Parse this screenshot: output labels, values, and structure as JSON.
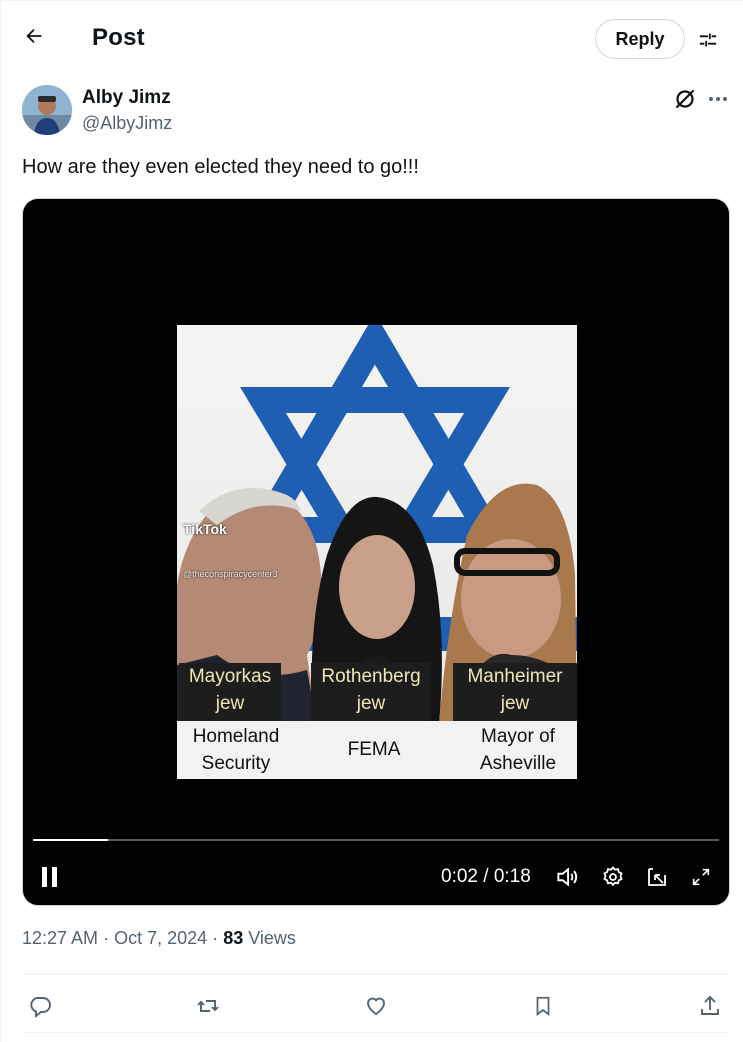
{
  "header": {
    "title": "Post",
    "back_icon": "arrow-left-icon",
    "reply_label": "Reply",
    "filter_icon": "sliders-icon"
  },
  "author": {
    "name": "Alby Jimz",
    "handle": "@AlbyJimz",
    "grok_icon": "grok-icon",
    "more_icon": "more-horizontal-icon"
  },
  "post": {
    "text": "How are they even elected they need to go!!!"
  },
  "video": {
    "watermark": "TikTok",
    "watermark_handle": "@theconspiracycenter3",
    "people": [
      {
        "name": "Mayorkas",
        "tag": "jew",
        "role_line1": "Homeland",
        "role_line2": "Security"
      },
      {
        "name": "Rothenberg",
        "tag": "jew",
        "role_line1": "FEMA",
        "role_line2": ""
      },
      {
        "name": "Manheimer",
        "tag": "jew",
        "role_line1": "Mayor of",
        "role_line2": "Asheville"
      }
    ],
    "current_time": "0:02",
    "duration": "0:18",
    "time_display": "0:02 / 0:18",
    "progress_fraction": 0.11,
    "star_color": "#1e5fb3",
    "controls": [
      "pause-icon",
      "volume-icon",
      "settings-icon",
      "pip-icon",
      "fullscreen-icon"
    ]
  },
  "meta": {
    "time": "12:27 AM",
    "date": "Oct 7, 2024",
    "dot": "·",
    "views_count": "83",
    "views_label": "Views"
  },
  "actions": [
    "reply-icon",
    "repost-icon",
    "like-icon",
    "bookmark-icon",
    "share-icon"
  ]
}
